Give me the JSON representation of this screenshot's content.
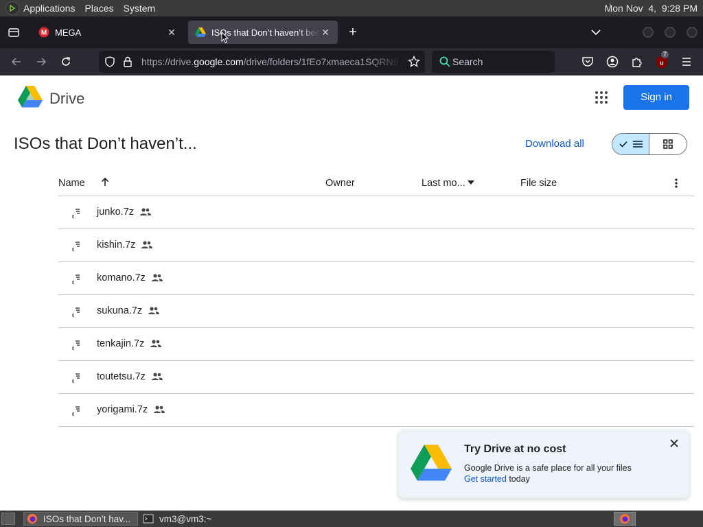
{
  "top_panel": {
    "menus": [
      "Applications",
      "Places",
      "System"
    ],
    "clock": "Mon Nov  4,  9:28 PM"
  },
  "browser": {
    "tabs": [
      {
        "title": "MEGA",
        "icon": "mega-icon"
      },
      {
        "title": "ISOs that Don’t haven’t bee",
        "icon": "google-drive-icon",
        "active": true
      }
    ],
    "url_prefix": "https://drive.",
    "url_domain": "google.com",
    "url_suffix": "/drive/folders/1fEo7xmaeca1SQRN9",
    "search_placeholder": "Search",
    "extension_badge": "7"
  },
  "drive": {
    "product_name": "Drive",
    "sign_in_label": "Sign in",
    "folder_title": "ISOs that Don’t haven’t...",
    "download_all_label": "Download all",
    "columns": {
      "name": "Name",
      "owner": "Owner",
      "last_modified": "Last mo...",
      "file_size": "File size"
    },
    "files": [
      {
        "name": "junko.7z",
        "shared": true
      },
      {
        "name": "kishin.7z",
        "shared": true
      },
      {
        "name": "komano.7z",
        "shared": true
      },
      {
        "name": "sukuna.7z",
        "shared": true
      },
      {
        "name": "tenkajin.7z",
        "shared": true
      },
      {
        "name": "toutetsu.7z",
        "shared": true
      },
      {
        "name": "yorigami.7z",
        "shared": true
      }
    ],
    "promo": {
      "title": "Try Drive at no cost",
      "description": "Google Drive is a safe place for all your files",
      "link_label": "Get started",
      "link_suffix": " today"
    }
  },
  "taskbar": {
    "items": [
      {
        "label": "ISOs that Don’t hav...",
        "icon": "firefox-icon",
        "active": true
      },
      {
        "label": "vm3@vm3:~",
        "icon": "terminal-icon",
        "active": false
      }
    ]
  },
  "colors": {
    "accent_blue": "#1a73e8",
    "link_blue": "#0b57d0",
    "toggle_active": "#c2e7ff",
    "browser_dark": "#1c1b22"
  }
}
